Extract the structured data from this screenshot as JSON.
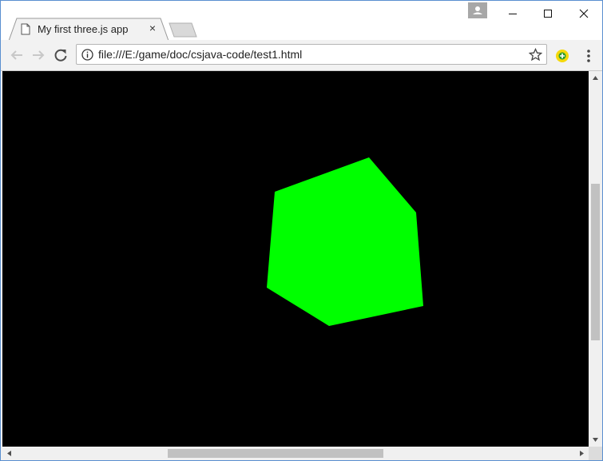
{
  "tab": {
    "title": "My first three.js app",
    "close_glyph": "×",
    "page_icon": "page-icon"
  },
  "new_tab": {
    "icon": "new-tab-icon"
  },
  "window_controls": {
    "profile_icon": "profile-icon",
    "minimize_icon": "minimize-icon",
    "maximize_icon": "maximize-icon",
    "close_icon": "close-icon"
  },
  "toolbar": {
    "back_icon": "back-arrow-icon",
    "forward_icon": "forward-arrow-icon",
    "reload_icon": "reload-icon",
    "url": "file:///E:/game/doc/csjava-code/test1.html",
    "info_icon": "info-icon",
    "bookmark_icon": "star-icon",
    "extension_icon": "extension-icon",
    "menu_icon": "menu-icon"
  },
  "scene": {
    "background": "#000000",
    "cube_color": "#00ff00"
  }
}
